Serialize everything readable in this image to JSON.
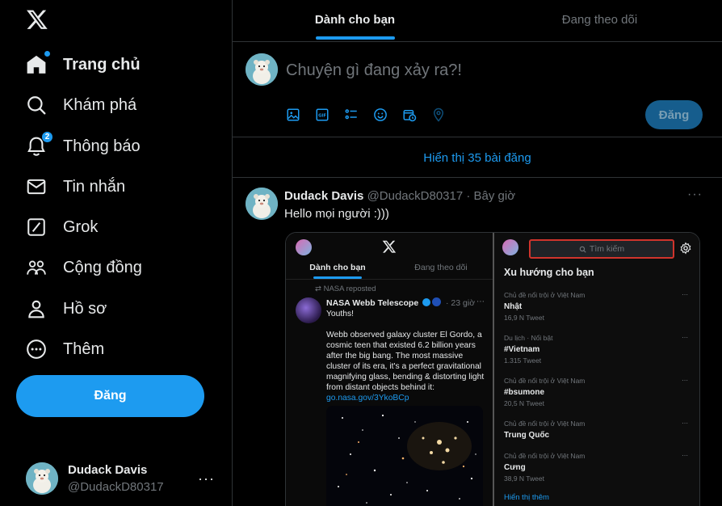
{
  "nav": {
    "items": [
      {
        "label": "Trang chủ",
        "icon": "home-icon"
      },
      {
        "label": "Khám phá",
        "icon": "search-icon"
      },
      {
        "label": "Thông báo",
        "icon": "bell-icon",
        "badge": "2"
      },
      {
        "label": "Tin nhắn",
        "icon": "envelope-icon"
      },
      {
        "label": "Grok",
        "icon": "grok-icon"
      },
      {
        "label": "Cộng đồng",
        "icon": "people-icon"
      },
      {
        "label": "Hồ sơ",
        "icon": "person-icon"
      },
      {
        "label": "Thêm",
        "icon": "more-circle-icon"
      }
    ],
    "post_button": "Đăng"
  },
  "account": {
    "name": "Dudack Davis",
    "handle": "@DudackD80317",
    "more": "···"
  },
  "tabs": [
    {
      "label": "Dành cho bạn"
    },
    {
      "label": "Đang theo dõi"
    }
  ],
  "composer": {
    "placeholder": "Chuyện gì đang xảy ra?!",
    "submit": "Đăng"
  },
  "feed": {
    "show_new": "Hiển thị 35 bài đăng"
  },
  "tweet": {
    "name": "Dudack Davis",
    "meta": "@DudackD80317 · Bây giờ",
    "text": "Hello mọi người :)))",
    "more": "···"
  },
  "embedded_screenshot": {
    "left": {
      "tabs": [
        "Dành cho bạn",
        "Đang theo dõi"
      ],
      "repost": "⇄ NASA reposted",
      "author": "NASA Webb Telescope",
      "time": "· 23 giờ",
      "line1": "Youths!",
      "body": "Webb observed galaxy cluster El Gordo, a cosmic teen that existed 6.2 billion years after the big bang. The most massive cluster of its era, it's a perfect gravitational magnifying glass, bending & distorting light from distant objects behind it:",
      "link": "go.nasa.gov/3YkoBCp"
    },
    "right": {
      "search_placeholder": "Tìm kiếm",
      "trend_title": "Xu hướng cho bạn",
      "trends": [
        {
          "context": "Chủ đề nổi trội ở Việt Nam",
          "name": "Nhật",
          "count": "16,9 N Tweet"
        },
        {
          "context": "Du lịch · Nổi bật",
          "name": "#Vietnam",
          "count": "1.315 Tweet"
        },
        {
          "context": "Chủ đề nổi trội ở Việt Nam",
          "name": "#bsumone",
          "count": "20,5 N Tweet"
        },
        {
          "context": "Chủ đề nổi trội ở Việt Nam",
          "name": "Trung Quốc",
          "count": ""
        },
        {
          "context": "Chủ đề nổi trội ở Việt Nam",
          "name": "Cưng",
          "count": "38,9 N Tweet"
        }
      ],
      "show_more": "Hiển thị thêm"
    }
  },
  "colors": {
    "accent": "#1d9bf0",
    "background": "#000000",
    "text": "#e7e9ea",
    "muted": "#71767b",
    "border": "#2f3336"
  }
}
